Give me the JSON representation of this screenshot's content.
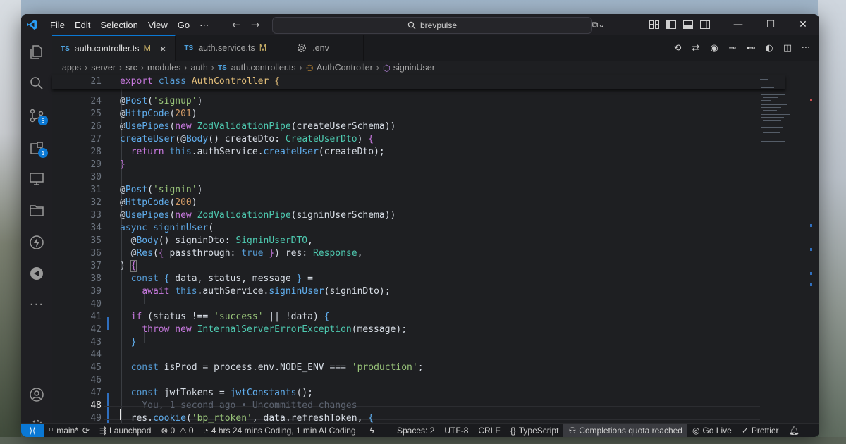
{
  "menu": [
    "File",
    "Edit",
    "Selection",
    "View",
    "Go",
    "···"
  ],
  "search": {
    "text": "brevpulse"
  },
  "activity_badges": {
    "source_control": "5",
    "extensions": "1"
  },
  "tabs": [
    {
      "lang": "TS",
      "label": "auth.controller.ts",
      "modified": "M",
      "close": "✕"
    },
    {
      "lang": "TS",
      "label": "auth.service.ts",
      "modified": "M"
    },
    {
      "lang": "",
      "label": ".env",
      "modified": ""
    }
  ],
  "breadcrumb": [
    "apps",
    "server",
    "src",
    "modules",
    "auth",
    "auth.controller.ts",
    "AuthController",
    "signinUser"
  ],
  "breadcrumb_ts": "TS",
  "editor": {
    "sticky_line": "21",
    "lines": [
      "24",
      "25",
      "26",
      "27",
      "28",
      "29",
      "30",
      "31",
      "32",
      "33",
      "34",
      "35",
      "36",
      "37",
      "38",
      "39",
      "40",
      "41",
      "42",
      "43",
      "44",
      "45",
      "46",
      "47",
      "48",
      "49"
    ],
    "current_line": "48",
    "blame": "You, 1 second ago • Uncommitted changes"
  },
  "status": {
    "branch": "main*",
    "launchpad": "Launchpad",
    "errors": "0",
    "warnings": "0",
    "time": "4 hrs 24 mins Coding, 1 min AI Coding",
    "spaces": "Spaces: 2",
    "encoding": "UTF-8",
    "eol": "CRLF",
    "language": "TypeScript",
    "copilot": "Completions quota reached",
    "golive": "Go Live",
    "prettier": "Prettier"
  },
  "colors": {
    "accent": "#0a78d4",
    "keyword": "#c678dd",
    "function": "#61afef",
    "string": "#98c379",
    "number": "#d19a66",
    "class": "#4ec9b0"
  }
}
